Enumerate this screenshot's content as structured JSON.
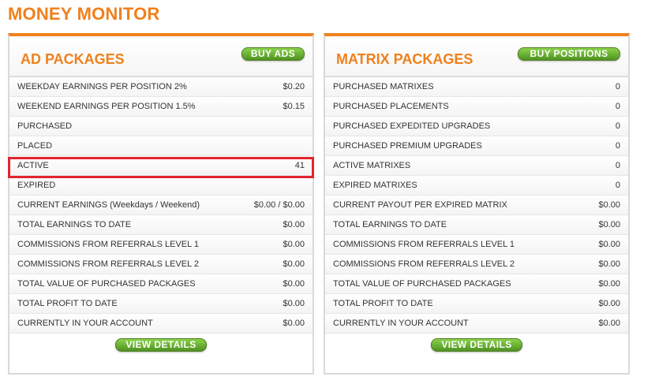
{
  "page": {
    "title": "MONEY MONITOR"
  },
  "ad_packages": {
    "title": "AD PACKAGES",
    "buy_label": "BUY ADS",
    "rows": [
      {
        "label": "WEEKDAY EARNINGS PER POSITION 2%",
        "value": "$0.20"
      },
      {
        "label": "WEEKEND EARNINGS PER POSITION 1.5%",
        "value": "$0.15"
      },
      {
        "label": "PURCHASED",
        "value": ""
      },
      {
        "label": "PLACED",
        "value": ""
      },
      {
        "label": "ACTIVE",
        "value": "41"
      },
      {
        "label": "EXPIRED",
        "value": ""
      },
      {
        "label": "CURRENT EARNINGS (Weekdays / Weekend)",
        "value": "$0.00 / $0.00"
      },
      {
        "label": "TOTAL EARNINGS TO DATE",
        "value": "$0.00"
      },
      {
        "label": "COMMISSIONS FROM REFERRALS LEVEL 1",
        "value": "$0.00"
      },
      {
        "label": "COMMISSIONS FROM REFERRALS LEVEL 2",
        "value": "$0.00"
      },
      {
        "label": "TOTAL VALUE OF PURCHASED PACKAGES",
        "value": "$0.00"
      },
      {
        "label": "TOTAL PROFIT TO DATE",
        "value": "$0.00"
      },
      {
        "label": "CURRENTLY IN YOUR ACCOUNT",
        "value": "$0.00"
      }
    ],
    "details_label": "VIEW DETAILS"
  },
  "matrix_packages": {
    "title": "MATRIX PACKAGES",
    "buy_label": "BUY POSITIONS",
    "rows": [
      {
        "label": "PURCHASED MATRIXES",
        "value": "0"
      },
      {
        "label": "PURCHASED PLACEMENTS",
        "value": "0"
      },
      {
        "label": "PURCHASED EXPEDITED UPGRADES",
        "value": "0"
      },
      {
        "label": "PURCHASED PREMIUM UPGRADES",
        "value": "0"
      },
      {
        "label": "ACTIVE MATRIXES",
        "value": "0"
      },
      {
        "label": "EXPIRED MATRIXES",
        "value": "0"
      },
      {
        "label": "CURRENT PAYOUT PER EXPIRED MATRIX",
        "value": "$0.00"
      },
      {
        "label": "TOTAL EARNINGS TO DATE",
        "value": "$0.00"
      },
      {
        "label": "COMMISSIONS FROM REFERRALS LEVEL 1",
        "value": "$0.00"
      },
      {
        "label": "COMMISSIONS FROM REFERRALS LEVEL 2",
        "value": "$0.00"
      },
      {
        "label": "TOTAL VALUE OF PURCHASED PACKAGES",
        "value": "$0.00"
      },
      {
        "label": "TOTAL PROFIT TO DATE",
        "value": "$0.00"
      },
      {
        "label": "CURRENTLY IN YOUR ACCOUNT",
        "value": "$0.00"
      }
    ],
    "details_label": "VIEW DETAILS"
  },
  "colors": {
    "accent": "#f0801c",
    "button_green": "#5a9e2a",
    "highlight": "#e3242b"
  }
}
